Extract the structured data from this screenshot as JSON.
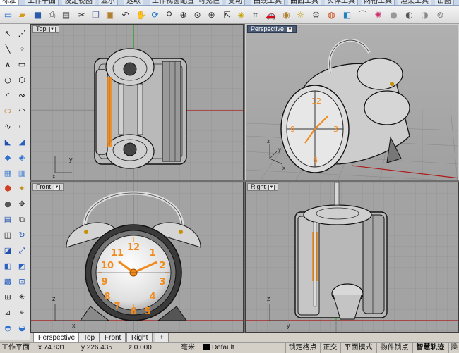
{
  "ribbon_tabs": [
    {
      "label": "标准",
      "active": true
    },
    {
      "label": "工作平面"
    },
    {
      "label": "设定视图"
    },
    {
      "label": "显示"
    },
    {
      "label": "选取"
    },
    {
      "label": "工作视窗配置"
    },
    {
      "label": "可见性"
    },
    {
      "label": "变动"
    },
    {
      "label": "曲线工具"
    },
    {
      "label": "曲面工具"
    },
    {
      "label": "实体工具"
    },
    {
      "label": "网格工具"
    },
    {
      "label": "渲染工具"
    },
    {
      "label": "出图"
    }
  ],
  "toolbar_icons": [
    "new-file-icon",
    "open-file-icon",
    "save-icon",
    "print-icon",
    "import-icon",
    "cut-icon",
    "copy-icon",
    "paste-icon",
    "undo-icon",
    "pan-icon",
    "rotate-view-icon",
    "zoom-icon",
    "zoom-window-icon",
    "zoom-extents-icon",
    "zoom-selected-icon",
    "select-icon",
    "properties-icon",
    "snap-icon",
    "curve-icon",
    "layers-icon",
    "car-icon",
    "render-icon",
    "lightbulb-icon",
    "options-icon",
    "material-icon",
    "color-wheel-icon",
    "sphere-icon",
    "env-sphere-icon",
    "more-icon"
  ],
  "viewports": {
    "top": {
      "title": "Top"
    },
    "perspective": {
      "title": "Perspective"
    },
    "front": {
      "title": "Front"
    },
    "right": {
      "title": "Right"
    }
  },
  "axis_labels": {
    "x": "x",
    "y": "y",
    "z": "z"
  },
  "viewport_tabs": [
    {
      "label": "Perspective",
      "active": true
    },
    {
      "label": "Top"
    },
    {
      "label": "Front"
    },
    {
      "label": "Right"
    }
  ],
  "add_tab_label": "+",
  "status": {
    "cplane": "工作平面",
    "x": "x 74.831",
    "y": "y 226.435",
    "z": "z 0.000",
    "unit": "毫米",
    "layer": "Default",
    "osnap": "锁定格点",
    "ortho": "正交",
    "planar": "平面模式",
    "object_snap": "物件锁点",
    "smarttrack": "智慧轨迹",
    "gumball": "操"
  },
  "colors": {
    "grid_bg": "#a3a3a3",
    "x_axis": "#b01818",
    "y_axis": "#1a9a1a",
    "accent_orange": "#f08a1c"
  }
}
